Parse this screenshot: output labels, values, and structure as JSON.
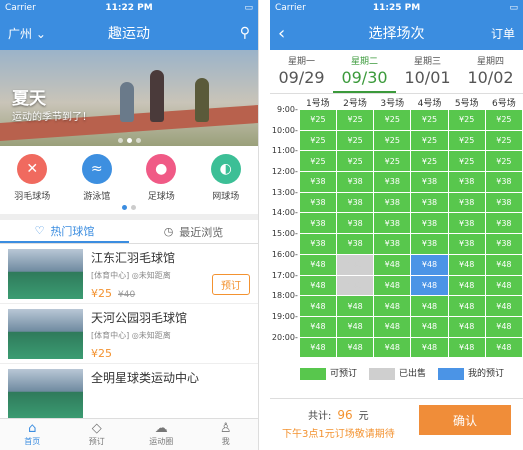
{
  "left": {
    "status": {
      "carrier": "Carrier",
      "time": "11:22 PM"
    },
    "nav": {
      "city": "广州",
      "title": "趣运动"
    },
    "banner": {
      "headline": "夏天",
      "subline": "运动的季节到了！"
    },
    "categories": [
      {
        "label": "羽毛球场",
        "color": "#f06a5f",
        "glyph": "✕"
      },
      {
        "label": "游泳馆",
        "color": "#3d8fe0",
        "glyph": "≈"
      },
      {
        "label": "足球场",
        "color": "#f05a86",
        "glyph": "●"
      },
      {
        "label": "网球场",
        "color": "#3cbf96",
        "glyph": "◐"
      }
    ],
    "tabs": {
      "hot": "热门球馆",
      "recent": "最近浏览"
    },
    "venues": [
      {
        "name": "江东汇羽毛球馆",
        "tag": "[体育中心]",
        "dist": "◎未知距离",
        "price": "¥25",
        "old_price": "¥40",
        "action": "预订"
      },
      {
        "name": "天河公园羽毛球馆",
        "tag": "[体育中心]",
        "dist": "◎未知距离",
        "price": "¥25",
        "old_price": "",
        "action": ""
      },
      {
        "name": "全明星球类运动中心",
        "tag": "",
        "dist": "",
        "price": "",
        "old_price": "",
        "action": ""
      }
    ],
    "bottom_nav": [
      "首页",
      "预订",
      "运动圈",
      "我"
    ]
  },
  "right": {
    "status": {
      "carrier": "Carrier",
      "time": "11:25 PM"
    },
    "nav": {
      "title": "选择场次",
      "orders": "订单"
    },
    "dates": [
      {
        "weekday": "星期一",
        "date": "09/29"
      },
      {
        "weekday": "星期二",
        "date": "09/30"
      },
      {
        "weekday": "星期三",
        "date": "10/01"
      },
      {
        "weekday": "星期四",
        "date": "10/02"
      }
    ],
    "courts": [
      "1号场",
      "2号场",
      "3号场",
      "4号场",
      "5号场",
      "6号场"
    ],
    "times": [
      "9:00-",
      "10:00-",
      "11:00-",
      "12:00-",
      "13:00-",
      "14:00-",
      "15:00-",
      "16:00-",
      "17:00-",
      "18:00-",
      "19:00-",
      "20:00-"
    ],
    "prices": [
      "¥25",
      "¥25",
      "¥25",
      "¥38",
      "¥38",
      "¥38",
      "¥38",
      "¥48",
      "¥48",
      "¥48",
      "¥48",
      "¥48"
    ],
    "sold": [
      [
        7,
        1
      ],
      [
        8,
        1
      ]
    ],
    "mine": [
      [
        7,
        3
      ],
      [
        8,
        3
      ]
    ],
    "legend": {
      "available": "可预订",
      "sold": "已出售",
      "mine": "我的预订"
    },
    "footer": {
      "total_label": "共计:",
      "total_value": "96",
      "unit": "元",
      "promo": "下午3点1元订场敬请期待",
      "confirm": "确认"
    }
  }
}
